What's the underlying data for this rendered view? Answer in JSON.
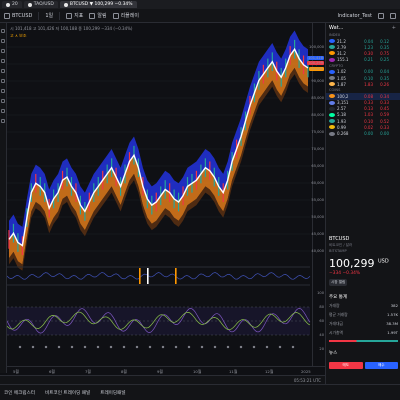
{
  "browser": {
    "tabs": [
      {
        "label": "20",
        "active": false
      },
      {
        "label": "TAO/USD",
        "active": false
      },
      {
        "label": "BTCUSD ▼ 100,299 −0.34%",
        "active": true
      }
    ]
  },
  "toolbar": {
    "symbol": "BTCUSD",
    "interval": "1일",
    "items": [
      "지표",
      "알림",
      "리플레이"
    ],
    "layout_name": "Indicator_Test"
  },
  "legend": {
    "line1": "시 101,418  고 101,426  저 100,188  종 100,299  −334 (−0.34%)",
    "line2": "고 ∧ 보조"
  },
  "price_axis": {
    "labels": [
      "100,000",
      "95,000",
      "90,000",
      "85,000",
      "80,000",
      "75,000",
      "70,000",
      "65,000",
      "60,000",
      "55,000",
      "50,000",
      "45,000",
      "40,000"
    ],
    "last_price": "100,299",
    "tag_upper": "101,418",
    "tag_lower": "99,000",
    "osc_labels": [
      "100",
      "80",
      "60",
      "40",
      "20"
    ]
  },
  "time_axis": {
    "labels": [
      "5월",
      "6월",
      "7월",
      "8월",
      "9월",
      "10월",
      "11월",
      "12월",
      "2025"
    ]
  },
  "status": {
    "clock": "05:53:21 UTC"
  },
  "bottom_bar": {
    "items": [
      "코인 에크립스터",
      "비트코인 트레이딩 패널",
      "트레이딩패널"
    ]
  },
  "watchlist": {
    "title": "Wat...",
    "groups": [
      {
        "label": "INDEX",
        "rows": [
          {
            "name": "21.2",
            "change": "0.04",
            "pct": "0.12",
            "dir": "up",
            "color": "#2962ff"
          },
          {
            "name": "2.79",
            "change": "1.23",
            "pct": "0.35",
            "dir": "up",
            "color": "#26a69a"
          },
          {
            "name": "31.2",
            "change": "0.30",
            "pct": "0.75",
            "dir": "dn",
            "color": "#ff9800"
          },
          {
            "name": "155.1",
            "change": "0.21",
            "pct": "0.25",
            "dir": "up",
            "color": "#9c27b0"
          }
        ]
      },
      {
        "label": "CRYPTO",
        "rows": [
          {
            "name": "1.02",
            "change": "0.00",
            "pct": "0.04",
            "dir": "up",
            "color": "#2962ff"
          },
          {
            "name": "1.05",
            "change": "0.10",
            "pct": "0.35",
            "dir": "up",
            "color": "#787b86"
          },
          {
            "name": "1.87",
            "change": "1.83",
            "pct": "0.26",
            "dir": "dn",
            "color": "#ffb74d"
          }
        ]
      },
      {
        "label": "COINS",
        "rows": [
          {
            "name": "100,2",
            "change": "0.08",
            "pct": "0.34",
            "dir": "dn",
            "color": "#f7931a",
            "selected": true
          },
          {
            "name": "3,151",
            "change": "0.33",
            "pct": "0.33",
            "dir": "dn",
            "color": "#627eea"
          },
          {
            "name": "2.57",
            "change": "0.13",
            "pct": "0.45",
            "dir": "dn",
            "color": "#23292f"
          },
          {
            "name": "5.18",
            "change": "1.03",
            "pct": "0.59",
            "dir": "dn",
            "color": "#00ffa3"
          },
          {
            "name": "1.93",
            "change": "0.10",
            "pct": "0.52",
            "dir": "dn",
            "color": "#26a69a"
          },
          {
            "name": "0.99",
            "change": "0.02",
            "pct": "0.33",
            "dir": "dn",
            "color": "#f0b90b"
          },
          {
            "name": "0.268",
            "change": "0.00",
            "pct": "0.00",
            "dir": "up",
            "color": "#787b86"
          }
        ]
      }
    ]
  },
  "details": {
    "symbol": "BTCUSD",
    "subtitle": "비트코인 / 달러",
    "exchange": "BITSTAMP",
    "price": "100,299",
    "price_suffix": "USD",
    "change": "−334 −0.34%",
    "pill": "시장 열림",
    "section": "주요 통계",
    "stats": [
      {
        "k": "거래량",
        "v": "382"
      },
      {
        "k": "평균 거래량",
        "v": "1.57K"
      },
      {
        "k": "거래대금",
        "v": "38.3M"
      },
      {
        "k": "시가총액",
        "v": "1.99T"
      }
    ],
    "sec2": "뉴스",
    "buy": "매수",
    "sell": "매도"
  },
  "chart_data": {
    "type": "line",
    "series": [
      {
        "values": [
          45,
          47,
          44,
          43,
          52,
          60,
          63,
          62,
          60,
          55,
          58,
          60,
          64,
          65,
          62,
          60,
          56,
          54,
          57,
          60,
          62,
          64,
          66,
          68,
          65,
          62,
          66,
          70,
          72,
          68,
          62,
          58,
          56,
          57,
          59,
          61,
          60,
          58,
          57,
          59,
          62,
          63,
          64,
          66,
          68,
          67,
          65,
          62,
          60,
          64,
          70,
          74,
          78,
          83,
          88,
          92,
          96,
          98,
          100,
          102,
          99,
          97,
          100,
          104,
          106,
          103,
          101,
          100
        ]
      }
    ],
    "ylim": [
      40000,
      108000
    ],
    "y_scale_note": "values in thousands USD"
  }
}
